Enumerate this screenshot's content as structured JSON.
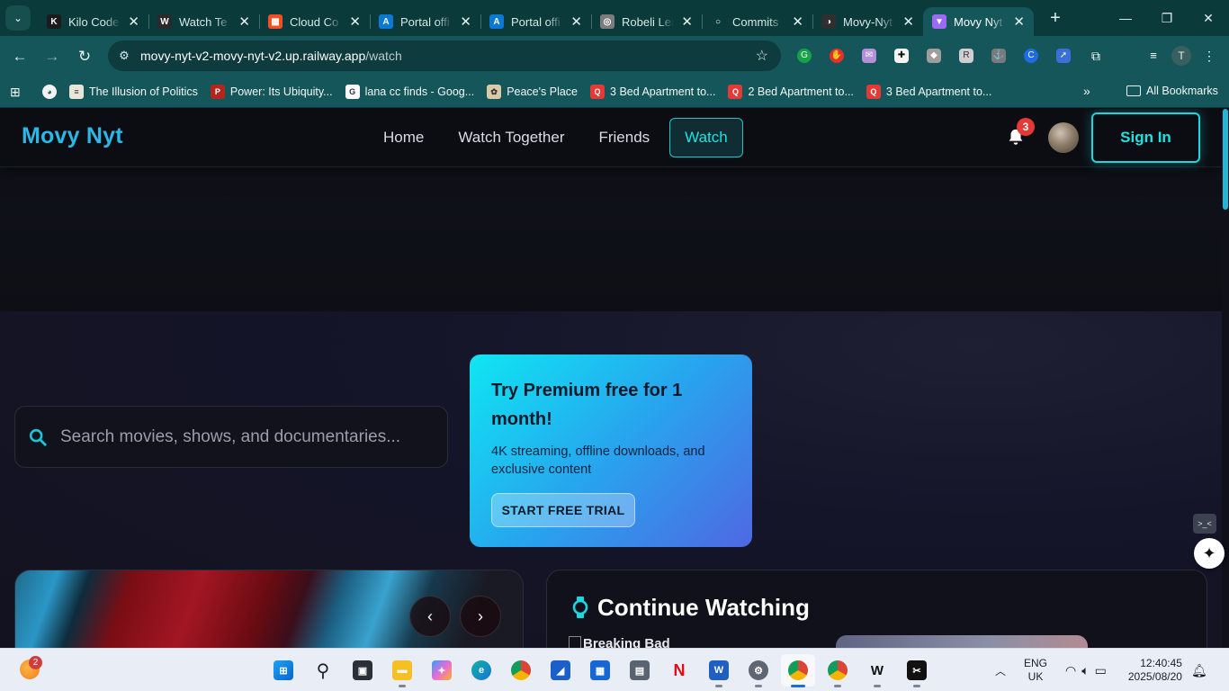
{
  "browser": {
    "tabs": [
      {
        "title": "Kilo Code",
        "favicon_color": "#1b1b1b",
        "favicon_text": "K"
      },
      {
        "title": "Watch Te",
        "favicon_color": "#2a2a2a",
        "favicon_text": "W"
      },
      {
        "title": "Cloud Co",
        "favicon_color": "#f25022",
        "favicon_text": "▦"
      },
      {
        "title": "Portal offi",
        "favicon_color": "#0b78d4",
        "favicon_text": "A"
      },
      {
        "title": "Portal offi",
        "favicon_color": "#0b78d4",
        "favicon_text": "A"
      },
      {
        "title": "Robeli Lea",
        "favicon_color": "#7c7c7c",
        "favicon_text": "◎"
      },
      {
        "title": "Commits",
        "favicon_color": "#0b3a3a",
        "favicon_text": "○"
      },
      {
        "title": "Movy-Nyt",
        "favicon_color": "#2f2f2f",
        "favicon_text": "◑"
      },
      {
        "title": "Movy Nyt",
        "favicon_color": "#9b6bf2",
        "favicon_text": "▼",
        "active": true
      }
    ],
    "url_host": "movy-nyt-v2-movy-nyt-v2.up.railway.app",
    "url_path": "/watch",
    "profile_initial": "T",
    "bookmarks": [
      {
        "label": "The Illusion of Politics",
        "icon_color": "#e8e4d8",
        "icon_text": "≡"
      },
      {
        "label": "Power: Its Ubiquity...",
        "icon_color": "#b3261e",
        "icon_text": "P"
      },
      {
        "label": "lana cc finds - Goog...",
        "icon_color": "#ffffff",
        "icon_text": "G"
      },
      {
        "label": "Peace's Place",
        "icon_color": "#d9c9a8",
        "icon_text": "✿"
      },
      {
        "label": "3 Bed Apartment to...",
        "icon_color": "#e53935",
        "icon_text": "Q"
      },
      {
        "label": "2 Bed Apartment to...",
        "icon_color": "#e53935",
        "icon_text": "Q"
      },
      {
        "label": "3 Bed Apartment to...",
        "icon_color": "#e53935",
        "icon_text": "Q"
      }
    ],
    "all_bookmarks_label": "All Bookmarks"
  },
  "site": {
    "logo": "Movy Nyt",
    "nav": [
      {
        "label": "Home",
        "active": false
      },
      {
        "label": "Watch Together",
        "active": false
      },
      {
        "label": "Friends",
        "active": false
      },
      {
        "label": "Watch",
        "active": true
      }
    ],
    "notification_count": "3",
    "sign_in_label": "Sign In",
    "accent_color": "#1fe2e2"
  },
  "search": {
    "placeholder": "Search movies, shows, and documentaries..."
  },
  "promo": {
    "title": "Try Premium free for 1 month!",
    "description": "4K streaming, offline downloads, and exclusive content",
    "button_label": "START FREE TRIAL"
  },
  "continue_watching": {
    "title": "Continue Watching",
    "first_item_alt": "Breaking Bad"
  },
  "taskbar": {
    "weather_badge": "2",
    "lang_line1": "ENG",
    "lang_line2": "UK",
    "time": "12:40:45",
    "date": "2025/08/20"
  }
}
